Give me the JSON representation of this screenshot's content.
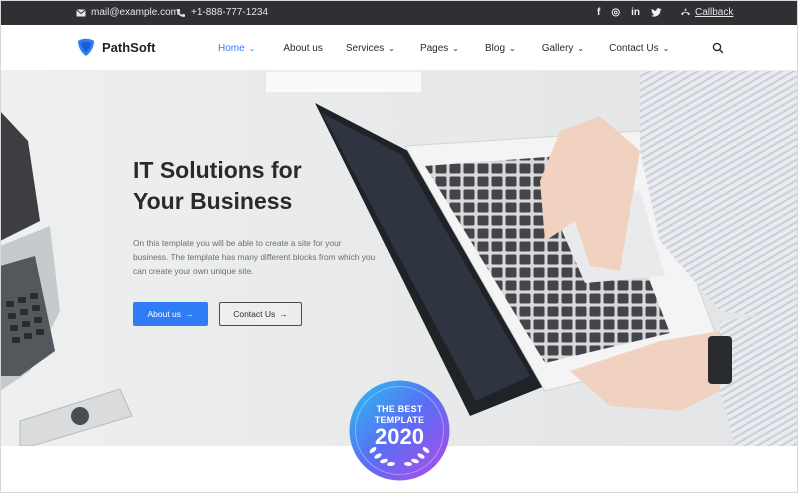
{
  "topbar": {
    "email": "mail@example.com",
    "phone": "+1-888-777-1234",
    "socials": [
      {
        "icon": "facebook-icon",
        "glyph": "f"
      },
      {
        "icon": "instagram-icon",
        "glyph": "◎"
      },
      {
        "icon": "linkedin-icon",
        "glyph": "in"
      },
      {
        "icon": "twitter-icon",
        "glyph": "🐦"
      }
    ],
    "callback_label": "Callback"
  },
  "brand": {
    "name": "PathSoft",
    "logo_color": "#2f7df6"
  },
  "nav": {
    "items": [
      {
        "label": "Home",
        "active": true
      },
      {
        "label": "About us",
        "active": false
      },
      {
        "label": "Services",
        "active": false
      },
      {
        "label": "Pages",
        "active": false
      },
      {
        "label": "Blog",
        "active": false
      },
      {
        "label": "Gallery",
        "active": false
      },
      {
        "label": "Contact Us",
        "active": false
      }
    ]
  },
  "hero": {
    "headline_line1": "IT Solutions for",
    "headline_line2": "Your Business",
    "lede": "On this template you will be able to create a site for your business. The template has many different blocks from which you can create your own unique site.",
    "primary_button": "About us",
    "secondary_button": "Contact Us",
    "arrow": "→"
  },
  "badge": {
    "line1": "THE BEST",
    "line2": "TEMPLATE",
    "year": "2020"
  },
  "colors": {
    "accent": "#2f7df6",
    "topbar_bg": "#2f3033",
    "active_nav": "#2f7df6"
  }
}
